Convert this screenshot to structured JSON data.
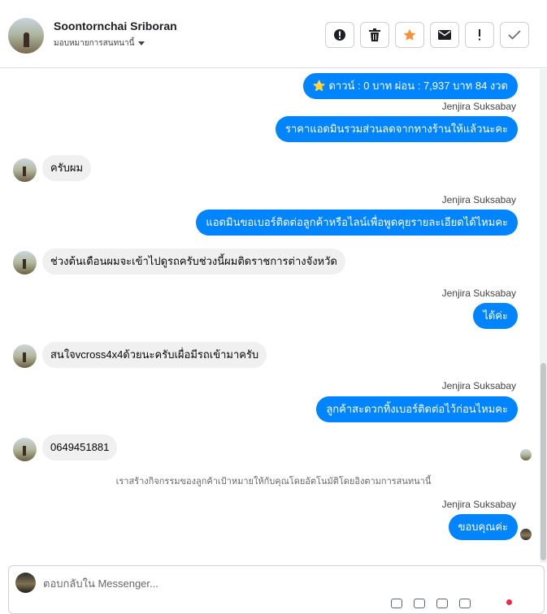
{
  "header": {
    "name": "Soontornchai Sriboran",
    "assign_label": "มอบหมายการสนทนานี้",
    "buttons": [
      {
        "icon": "alert-circle-icon"
      },
      {
        "icon": "trash-icon"
      },
      {
        "icon": "star-icon"
      },
      {
        "icon": "envelope-icon"
      },
      {
        "icon": "exclamation-icon"
      },
      {
        "icon": "check-icon"
      }
    ]
  },
  "messages": {
    "m1": {
      "text": "⭐ ดาวน์ : 0 บาท ผ่อน : 7,937 บาท 84 งวด"
    },
    "s2": "Jenjira Suksabay",
    "m2": {
      "text": "ราคาแอดมินรวมส่วนลดจากทางร้านให้แล้วนะคะ"
    },
    "m3": {
      "text": "ครับผม"
    },
    "s4": "Jenjira Suksabay",
    "m4": {
      "text": "แอดมินขอเบอร์ติดต่อลูกค้าหรือไลน์เพื่อพูดคุยรายละเอียดได้ไหมคะ"
    },
    "m5": {
      "text": "ช่วงต้นเดือนผมจะเข้าไปดูรถครับช่วงนี้ผมติดราชการต่างจังหวัด"
    },
    "s6": "Jenjira Suksabay",
    "m6": {
      "text": "ได้ค่ะ"
    },
    "m7": {
      "text": "สนใจvcross4x4ด้วยนะครับเผื่อมีรถเข้ามาครับ"
    },
    "s8": "Jenjira Suksabay",
    "m8": {
      "text": "ลูกค้าสะดวกทิ้งเบอร์ติดต่อไว้ก่อนไหมคะ"
    },
    "m9": {
      "text": "0649451881"
    },
    "system": "เราสร้างกิจกรรมของลูกค้าเป้าหมายให้กับคุณโดยอัตโนมัติโดยอิงตามการสนทนานี้",
    "s10": "Jenjira Suksabay",
    "m10": {
      "text": "ขอบคุณค่ะ"
    }
  },
  "composer": {
    "placeholder": "ตอบกลับใน Messenger..."
  },
  "colors": {
    "outgoing": "#0084ff",
    "incoming": "#f0f0f0",
    "star": "#f7923b"
  }
}
